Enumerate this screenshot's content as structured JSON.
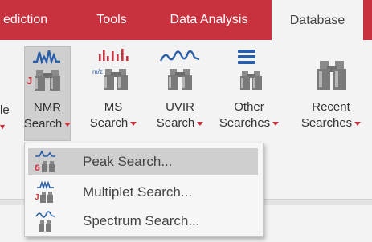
{
  "tabs": [
    {
      "label": "ediction"
    },
    {
      "label": "Tools"
    },
    {
      "label": "Data Analysis"
    },
    {
      "label": "Database"
    }
  ],
  "active_tab": "Database",
  "ribbon": {
    "partial_label_line1": "le",
    "partial_label_caret": "▾",
    "buttons": [
      {
        "line1": "NMR",
        "line2": "Search",
        "icon": "nmr-binoculars-icon",
        "icon_letter": "J"
      },
      {
        "line1": "MS",
        "line2": "Search",
        "icon": "ms-binoculars-icon",
        "icon_letter": "m/z"
      },
      {
        "line1": "UVIR",
        "line2": "Search",
        "icon": "uvir-binoculars-icon"
      },
      {
        "line1": "Other",
        "line2": "Searches",
        "icon": "list-binoculars-icon"
      },
      {
        "line1": "Recent",
        "line2": "Searches",
        "icon": "binoculars-icon"
      }
    ]
  },
  "dropdown": {
    "items": [
      {
        "label": "Peak Search...",
        "icon": "peak-search-icon",
        "icon_letter": "δ"
      },
      {
        "label": "Multiplet Search...",
        "icon": "multiplet-search-icon",
        "icon_letter": "J"
      },
      {
        "label": "Spectrum Search...",
        "icon": "spectrum-search-icon"
      }
    ]
  },
  "colors": {
    "accent": "#c8313e",
    "ribbon_bg": "#f3f3f3",
    "selected_bg": "#cfcfcf",
    "icon_blue": "#2a5ea8",
    "icon_gray": "#8a8a8a"
  }
}
